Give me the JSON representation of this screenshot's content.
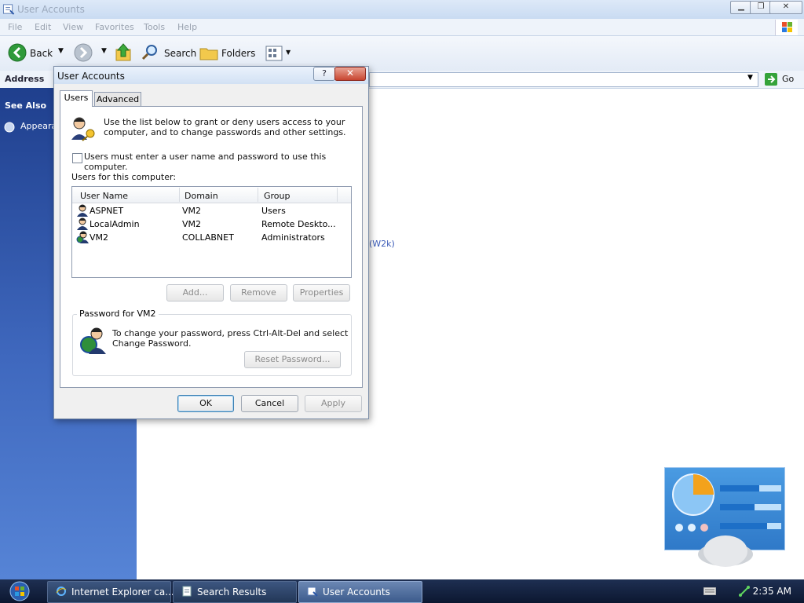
{
  "explorer": {
    "title": "User Accounts",
    "menu": [
      "File",
      "Edit",
      "View",
      "Favorites",
      "Tools",
      "Help"
    ],
    "toolbar": {
      "back": "Back",
      "search": "Search",
      "folders": "Folders"
    },
    "address_label": "Address",
    "go_label": "Go",
    "sidebar": {
      "see_also": "See Also",
      "appearance": "Appeara"
    },
    "content_snippet": "(W2k)"
  },
  "dialog": {
    "title": "User Accounts",
    "help_label": "?",
    "close_label": "✕",
    "tabs": [
      "Users",
      "Advanced"
    ],
    "intro_line1": "Use the list below to grant or deny users access to your",
    "intro_line2": "computer, and to change passwords and other settings.",
    "checkbox_label": "Users must enter a user name and password to use this computer.",
    "checkbox_checked": false,
    "users_label": "Users for this computer:",
    "columns": [
      "User Name",
      "Domain",
      "Group"
    ],
    "users": [
      {
        "name": "ASPNET",
        "domain": "VM2",
        "group": "Users"
      },
      {
        "name": "LocalAdmin",
        "domain": "VM2",
        "group": "Remote Deskto..."
      },
      {
        "name": "VM2",
        "domain": "COLLABNET",
        "group": "Administrators"
      }
    ],
    "buttons": {
      "add": "Add...",
      "remove": "Remove",
      "properties": "Properties"
    },
    "password_group": "Password for VM2",
    "password_line1": "To change your password, press Ctrl-Alt-Del and select",
    "password_line2": "Change Password.",
    "reset_password": "Reset Password...",
    "ok": "OK",
    "cancel": "Cancel",
    "apply": "Apply"
  },
  "taskbar": {
    "tasks": [
      "Internet Explorer ca...",
      "Search Results",
      "User Accounts"
    ],
    "clock": "2:35 AM"
  },
  "colors": {
    "sidebar": "#3f68be",
    "taskbar": "#0c1730",
    "accent": "#3c7fb1"
  }
}
